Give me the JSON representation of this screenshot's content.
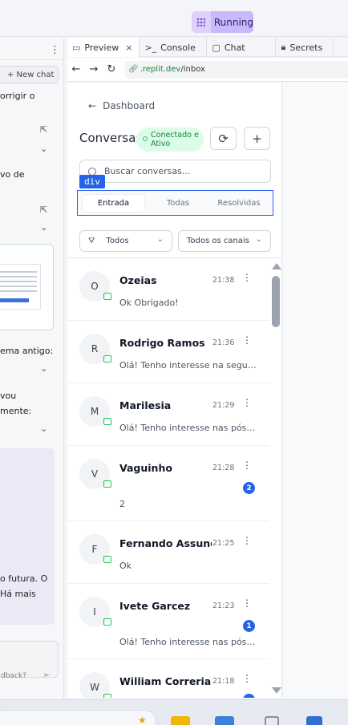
{
  "topbar": {
    "run_status": "Running"
  },
  "chat_panel": {
    "new_chat_label": "+ New chat",
    "lines": [
      "orrigir o",
      "vo de",
      "ema antigo:",
      "vou",
      "mente:",
      "o futura. O",
      "Há mais"
    ],
    "input_placeholder": "dback?"
  },
  "tabs": [
    {
      "label": "Preview",
      "icon": "monitor-icon",
      "closable": true
    },
    {
      "label": "Console",
      "icon": "terminal-icon"
    },
    {
      "label": "Chat",
      "icon": "chat-icon"
    },
    {
      "label": "Secrets",
      "icon": "lock-icon"
    }
  ],
  "browser": {
    "url_host": ".replit.dev",
    "url_path": "/inbox"
  },
  "inbox": {
    "back_label": "Dashboard",
    "title": "Conversas",
    "status_line1": "Conectado e",
    "status_line2": "Ativo",
    "search_placeholder": "Buscar conversas...",
    "inspector_tag": "div",
    "segments": [
      "Entrada",
      "Todas",
      "Resolvidas"
    ],
    "selected_segment": "Entrada",
    "filter_status": "Todos",
    "filter_channel": "Todos os canais",
    "conversations": [
      {
        "initial": "O",
        "name": "Ozeias",
        "time": "21:38",
        "preview": "Ok Obrigado!",
        "unread": ""
      },
      {
        "initial": "R",
        "name": "Rodrigo Ramos",
        "time": "21:36",
        "preview": "Olá! Tenho interesse na segund...",
        "unread": ""
      },
      {
        "initial": "M",
        "name": "Marilesia",
        "time": "21:29",
        "preview": "Olá! Tenho interesse nas pós d...",
        "unread": ""
      },
      {
        "initial": "V",
        "name": "Vaguinho",
        "time": "21:28",
        "preview": "2",
        "unread": "2"
      },
      {
        "initial": "F",
        "name": "Fernando Assunç...",
        "time": "21:25",
        "preview": "Ok",
        "unread": ""
      },
      {
        "initial": "I",
        "name": "Ivete Garcez",
        "time": "21:23",
        "preview": "Olá! Tenho interesse nas pós d...",
        "unread": "1"
      },
      {
        "initial": "W",
        "name": "William Correria",
        "time": "21:18",
        "preview": "",
        "unread": ""
      }
    ]
  },
  "colors": {
    "accent": "#2563eb",
    "status_bg": "#dcfce7",
    "status_text": "#15803d",
    "running_bg": "#c9b8fb"
  }
}
